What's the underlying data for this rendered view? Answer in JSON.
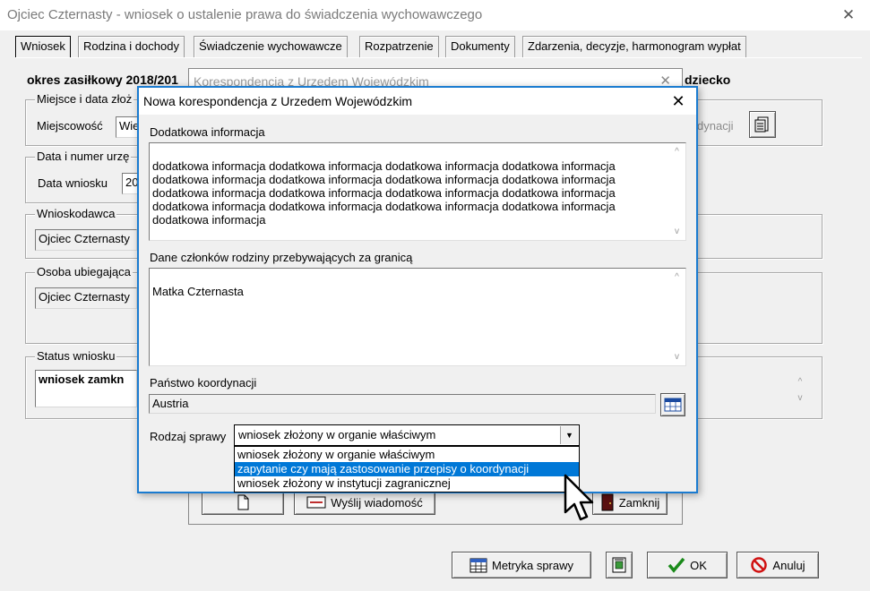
{
  "main_window": {
    "title": "Ojciec Czternasty - wniosek o ustalenie prawa do świadczenia wychowawczego",
    "tabs": [
      "Wniosek",
      "Rodzina i dochody",
      "Świadczenie wychowawcze",
      "Rozpatrzenie",
      "Dokumenty",
      "Zdarzenia, decyzje, harmonogram wypłat"
    ],
    "active_tab": "Wniosek",
    "period_label": "okres zasiłkowy 2018/201",
    "child_label": "dziecko",
    "place_group_title": "Miejsce i data złoż",
    "town_label": "Miejscowość",
    "town_value": "Wie",
    "coord_fragment": "dynacji",
    "date_group_title": "Data i numer urzę",
    "date_label": "Data wniosku",
    "date_value": "20",
    "applicant_group_title": "Wnioskodawca",
    "applicant_value": "Ojciec Czternasty",
    "person_group_title": "Osoba ubiegająca",
    "person_value": "Ojciec Czternasty",
    "status_group_title": "Status wniosku",
    "status_value": "wniosek zamkn",
    "buttons": {
      "metric": "Metryka sprawy",
      "ok": "OK",
      "cancel": "Anuluj"
    }
  },
  "bg_dialog": {
    "title": "Korespondencja z Urzedem Wojewódzkim",
    "send_button": "Wyślij wiadomość",
    "close_button": "Zamknij"
  },
  "dialog": {
    "title": "Nowa korespondencja z Urzedem Wojewódzkim",
    "info_label": "Dodatkowa informacja",
    "info_text": "dodatkowa informacja dodatkowa informacja dodatkowa informacja dodatkowa informacja\ndodatkowa informacja dodatkowa informacja dodatkowa informacja dodatkowa informacja\ndodatkowa informacja dodatkowa informacja dodatkowa informacja dodatkowa informacja\ndodatkowa informacja dodatkowa informacja dodatkowa informacja dodatkowa informacja\ndodatkowa informacja",
    "family_label": "Dane członków rodziny przebywających za granicą",
    "family_text": "Matka Czternasta",
    "country_label": "Państwo koordynacji",
    "country_value": "Austria",
    "case_type_label": "Rodzaj sprawy",
    "case_type_value": "wniosek złożony w organie właściwym",
    "case_type_options": [
      "wniosek złożony w organie właściwym",
      "zapytanie czy mają zastosowanie przepisy o koordynacji",
      "wniosek złożony w instytucji zagranicznej"
    ],
    "highlighted_option": 1
  },
  "colors": {
    "accent": "#1a7bd0",
    "selection": "#0078d7",
    "window_bg": "#f0f0f0"
  }
}
